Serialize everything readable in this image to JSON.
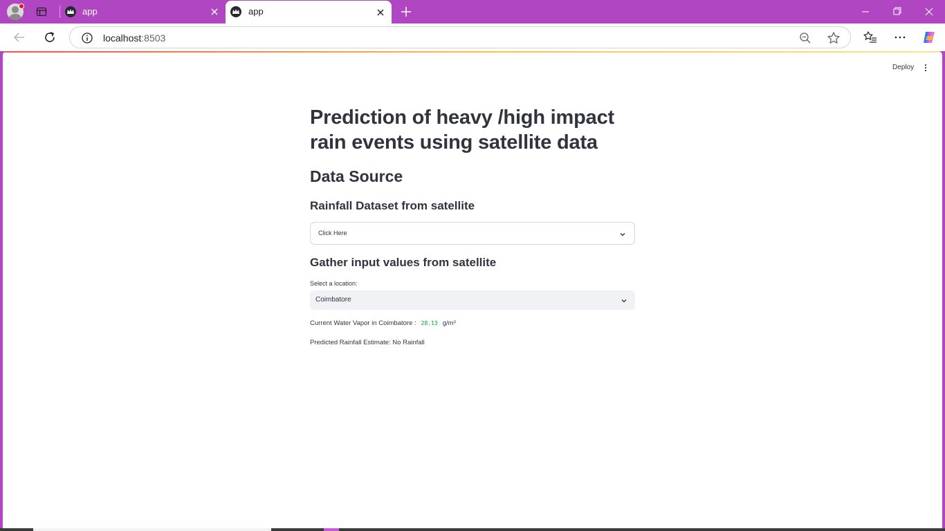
{
  "browser": {
    "tabs": [
      {
        "title": "app"
      },
      {
        "title": "app"
      }
    ],
    "url_host": "localhost",
    "url_port": ":8503"
  },
  "header": {
    "deploy_label": "Deploy"
  },
  "main": {
    "title": "Prediction of heavy /high impact rain events using satellite data",
    "section_heading": "Data Source",
    "dataset_heading": "Rainfall Dataset from satellite",
    "dataset_select_value": "Click Here",
    "gather_heading": "Gather input values from satellite",
    "location_label": "Select a location:",
    "location_value": "Coimbatore",
    "vapor_prefix": "Current Water Vapor in Coimbatore :",
    "vapor_value": "28.13",
    "vapor_unit": "g/m³",
    "rainfall_text": "Predicted Rainfall Estimate: No Rainfall"
  }
}
